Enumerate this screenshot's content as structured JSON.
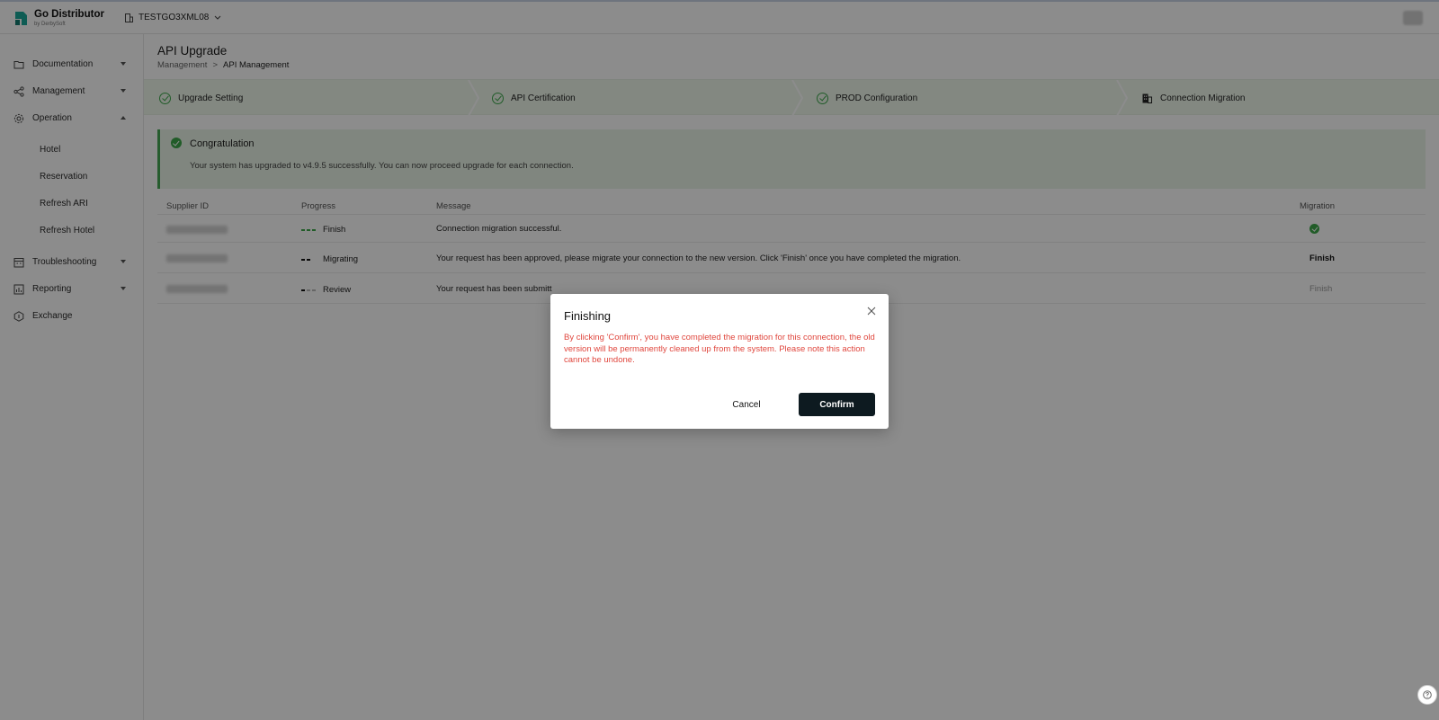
{
  "header": {
    "brand": "Go Distributor",
    "brand_sub": "by DerbySoft",
    "tenant": "TESTGO3XML08"
  },
  "sidebar": {
    "items": [
      {
        "label": "Documentation",
        "icon": "folder-icon"
      },
      {
        "label": "Management",
        "icon": "share-icon"
      },
      {
        "label": "Operation",
        "icon": "gear-icon"
      },
      {
        "label": "Troubleshooting",
        "icon": "calendar-icon"
      },
      {
        "label": "Reporting",
        "icon": "chart-icon"
      },
      {
        "label": "Exchange",
        "icon": "exchange-icon"
      }
    ],
    "sub_items": [
      "Hotel",
      "Reservation",
      "Refresh ARI",
      "Refresh Hotel"
    ]
  },
  "page": {
    "title": "API Upgrade",
    "breadcrumb": [
      "Management",
      ">",
      "API Management"
    ]
  },
  "steps": [
    {
      "label": "Upgrade Setting",
      "status": "done"
    },
    {
      "label": "API Certification",
      "status": "done"
    },
    {
      "label": "PROD Configuration",
      "status": "done"
    },
    {
      "label": "Connection Migration",
      "status": "current"
    }
  ],
  "alert": {
    "title": "Congratulation",
    "text": "Your system has upgraded to v4.9.5 successfully. You can now proceed upgrade for each connection."
  },
  "table": {
    "headers": [
      "Supplier ID",
      "Progress",
      "Message",
      "Migration"
    ],
    "rows": [
      {
        "progress": "Finish",
        "progress_level": 3,
        "message": "Connection migration successful.",
        "migration": ""
      },
      {
        "progress": "Migrating",
        "progress_level": 2,
        "message": "Your request has been approved, please migrate your connection to the new version. Click 'Finish' once you have completed the migration.",
        "migration": "Finish"
      },
      {
        "progress": "Review",
        "progress_level": 1,
        "message": "Your request has been submitt",
        "migration": "Finish"
      }
    ]
  },
  "modal": {
    "title": "Finishing",
    "text": "By clicking 'Confirm', you have completed the migration for this connection, the old version will be permanently cleaned up from the system. Please note this action cannot be undone.",
    "cancel": "Cancel",
    "confirm": "Confirm"
  },
  "colors": {
    "accent_green": "#3ca84a",
    "warning_red": "#e0473e",
    "primary_dark": "#0d1a20"
  }
}
